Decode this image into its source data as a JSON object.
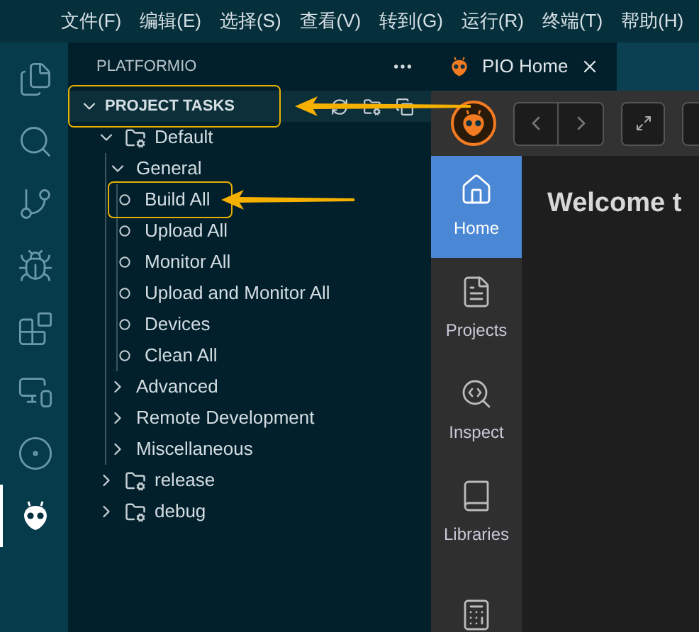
{
  "menu_bar": [
    "文件(F)",
    "编辑(E)",
    "选择(S)",
    "查看(V)",
    "转到(G)",
    "运行(R)",
    "终端(T)",
    "帮助(H)"
  ],
  "activity_bar": [
    {
      "kind": "explorer",
      "selected": false
    },
    {
      "kind": "search",
      "selected": false
    },
    {
      "kind": "source-control",
      "selected": false
    },
    {
      "kind": "run-debug",
      "selected": false
    },
    {
      "kind": "extensions",
      "selected": false
    },
    {
      "kind": "remote",
      "selected": false
    },
    {
      "kind": "graph",
      "selected": false
    },
    {
      "kind": "platformio",
      "selected": true
    }
  ],
  "sidebar": {
    "title": "PLATFORMIO",
    "section": {
      "label": "PROJECT TASKS",
      "expanded": true,
      "highlighted": true,
      "children": [
        {
          "label": "Default",
          "kind": "env",
          "expanded": true,
          "highlighted": false,
          "children": [
            {
              "label": "General",
              "kind": "group",
              "expanded": true,
              "highlighted": false,
              "children": [
                {
                  "label": "Build All",
                  "kind": "task",
                  "highlighted": true
                },
                {
                  "label": "Upload All",
                  "kind": "task",
                  "highlighted": false
                },
                {
                  "label": "Monitor All",
                  "kind": "task",
                  "highlighted": false
                },
                {
                  "label": "Upload and Monitor All",
                  "kind": "task",
                  "highlighted": false
                },
                {
                  "label": "Devices",
                  "kind": "task",
                  "highlighted": false
                },
                {
                  "label": "Clean All",
                  "kind": "task",
                  "highlighted": false
                }
              ]
            },
            {
              "label": "Advanced",
              "kind": "group",
              "expanded": false,
              "highlighted": false
            },
            {
              "label": "Remote Development",
              "kind": "group",
              "expanded": false,
              "highlighted": false
            },
            {
              "label": "Miscellaneous",
              "kind": "group",
              "expanded": false,
              "highlighted": false
            }
          ]
        },
        {
          "label": "release",
          "kind": "env",
          "expanded": false,
          "highlighted": false
        },
        {
          "label": "debug",
          "kind": "env",
          "expanded": false,
          "highlighted": false
        }
      ]
    }
  },
  "tab": {
    "label": "PIO Home",
    "selected": true
  },
  "pio_home": {
    "nav": [
      {
        "label": "Home",
        "kind": "home",
        "selected": true
      },
      {
        "label": "Projects",
        "kind": "projects",
        "selected": false
      },
      {
        "label": "Inspect",
        "kind": "inspect",
        "selected": false
      },
      {
        "label": "Libraries",
        "kind": "libraries",
        "selected": false
      },
      {
        "kind": "boards",
        "selected": false
      }
    ],
    "heading": "Welcome t"
  }
}
